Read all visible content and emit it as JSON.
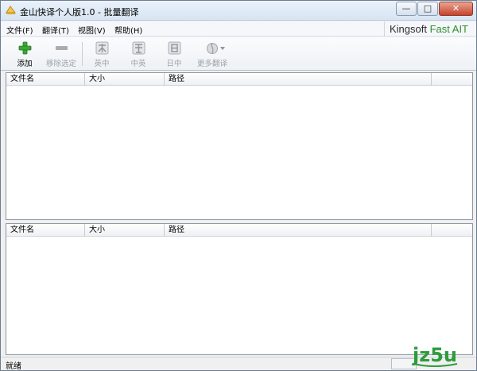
{
  "window": {
    "title": "金山快译个人版1.0 - 批量翻译",
    "minimize_glyph": "—",
    "maximize_glyph": "□",
    "close_glyph": "✕"
  },
  "menu": {
    "items": [
      {
        "label": "文件(F)"
      },
      {
        "label": "翻译(T)"
      },
      {
        "label": "视图(V)"
      },
      {
        "label": "帮助(H)"
      }
    ],
    "brand_part1": "Kingsoft ",
    "brand_part2": "Fast AIT"
  },
  "toolbar": {
    "add_label": "添加",
    "remove_label": "移除选定",
    "en_zh_label": "英中",
    "zh_en_label": "中英",
    "ja_zh_label": "日中",
    "more_label": "更多翻译",
    "icons": {
      "add": "plus-icon",
      "remove": "minus-icon",
      "en_zh": "translate-en-zh-icon",
      "zh_en": "translate-zh-en-icon",
      "ja_zh": "translate-ja-zh-icon",
      "more": "more-translate-icon"
    }
  },
  "top_list": {
    "columns": [
      "文件名",
      "大小",
      "路径"
    ]
  },
  "bottom_list": {
    "columns": [
      "文件名",
      "大小",
      "路径"
    ]
  },
  "status": {
    "text": "就绪"
  },
  "watermark": {
    "text": "jz5u",
    "color": "#2e9b3a"
  },
  "colors": {
    "brand_green": "#2f8f2f",
    "add_green": "#3aa832",
    "close_red": "#c7432b"
  }
}
